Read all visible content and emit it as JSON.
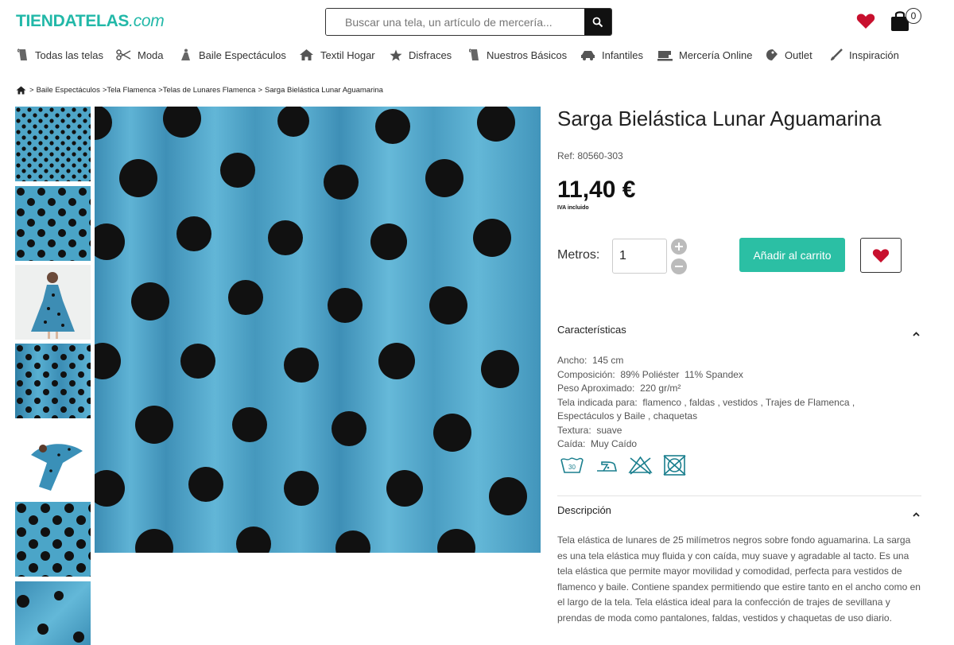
{
  "header": {
    "logo_text": "TIENDATELAS",
    "logo_suffix": ".com",
    "search_placeholder": "Buscar una tela, un artículo de mercería...",
    "cart_count": "0"
  },
  "nav": {
    "items": [
      {
        "label": "Todas las telas",
        "icon": "fabric-roll-icon"
      },
      {
        "label": "Moda",
        "icon": "scissors-icon"
      },
      {
        "label": "Baile Espectáculos",
        "icon": "dancer-icon"
      },
      {
        "label": "Textil Hogar",
        "icon": "home-icon"
      },
      {
        "label": "Disfraces",
        "icon": "star-icon"
      },
      {
        "label": "Nuestros Básicos",
        "icon": "fabric-roll-icon"
      },
      {
        "label": "Infantiles",
        "icon": "car-icon"
      },
      {
        "label": "Mercería Online",
        "icon": "sewing-machine-icon"
      },
      {
        "label": "Outlet",
        "icon": "tag-icon"
      },
      {
        "label": "Inspiración",
        "icon": "brush-icon"
      }
    ]
  },
  "breadcrumb": {
    "items": [
      "Baile Espectáculos",
      ">Tela Flamenca",
      ">Telas de Lunares Flamenca",
      "Sarga Bielástica Lunar Aguamarina"
    ]
  },
  "product": {
    "title": "Sarga Bielástica Lunar Aguamarina",
    "ref": "Ref: 80560-303",
    "price": "11,40 €",
    "iva": "IVA incluido",
    "metros_label": "Metros:",
    "quantity": "1",
    "add_to_cart": "Añadir al carrito"
  },
  "characteristics": {
    "heading": "Características",
    "rows": [
      {
        "label": "Ancho:",
        "value": "145 cm"
      },
      {
        "label": "Composición:",
        "value": "89% Poliéster  11% Spandex"
      },
      {
        "label": "Peso Aproximado:",
        "value": "220 gr/m²"
      },
      {
        "label": "Tela indicada para:",
        "value": "flamenco , faldas , vestidos , Trajes de Flamenca , Espectáculos y Baile , chaquetas"
      },
      {
        "label": "Textura:",
        "value": "suave"
      },
      {
        "label": "Caída:",
        "value": "Muy Caído"
      }
    ],
    "care_icons": [
      "wash-30-icon",
      "iron-low-icon",
      "no-bleach-icon",
      "no-tumble-dry-icon"
    ]
  },
  "description": {
    "heading": "Descripción",
    "text": "Tela elástica de lunares de 25 milímetros negros sobre fondo aguamarina. La sarga es una tela elástica muy fluida y con caída, muy suave y agradable al tacto. Es una tela elástica que permite mayor movilidad y comodidad, perfecta para vestidos de flamenco y baile. Contiene spandex permitiendo que estire tanto en el ancho como en el largo de la tela. Tela elástica ideal para la confección de trajes de sevillana y prendas de moda como pantalones, faldas, vestidos y chaquetas de uso diario."
  },
  "colors": {
    "brand": "#22b8a8",
    "button": "#2bbfa4",
    "heart": "#c8102e",
    "fabric": "#4fa6c8",
    "dot": "#111111"
  }
}
